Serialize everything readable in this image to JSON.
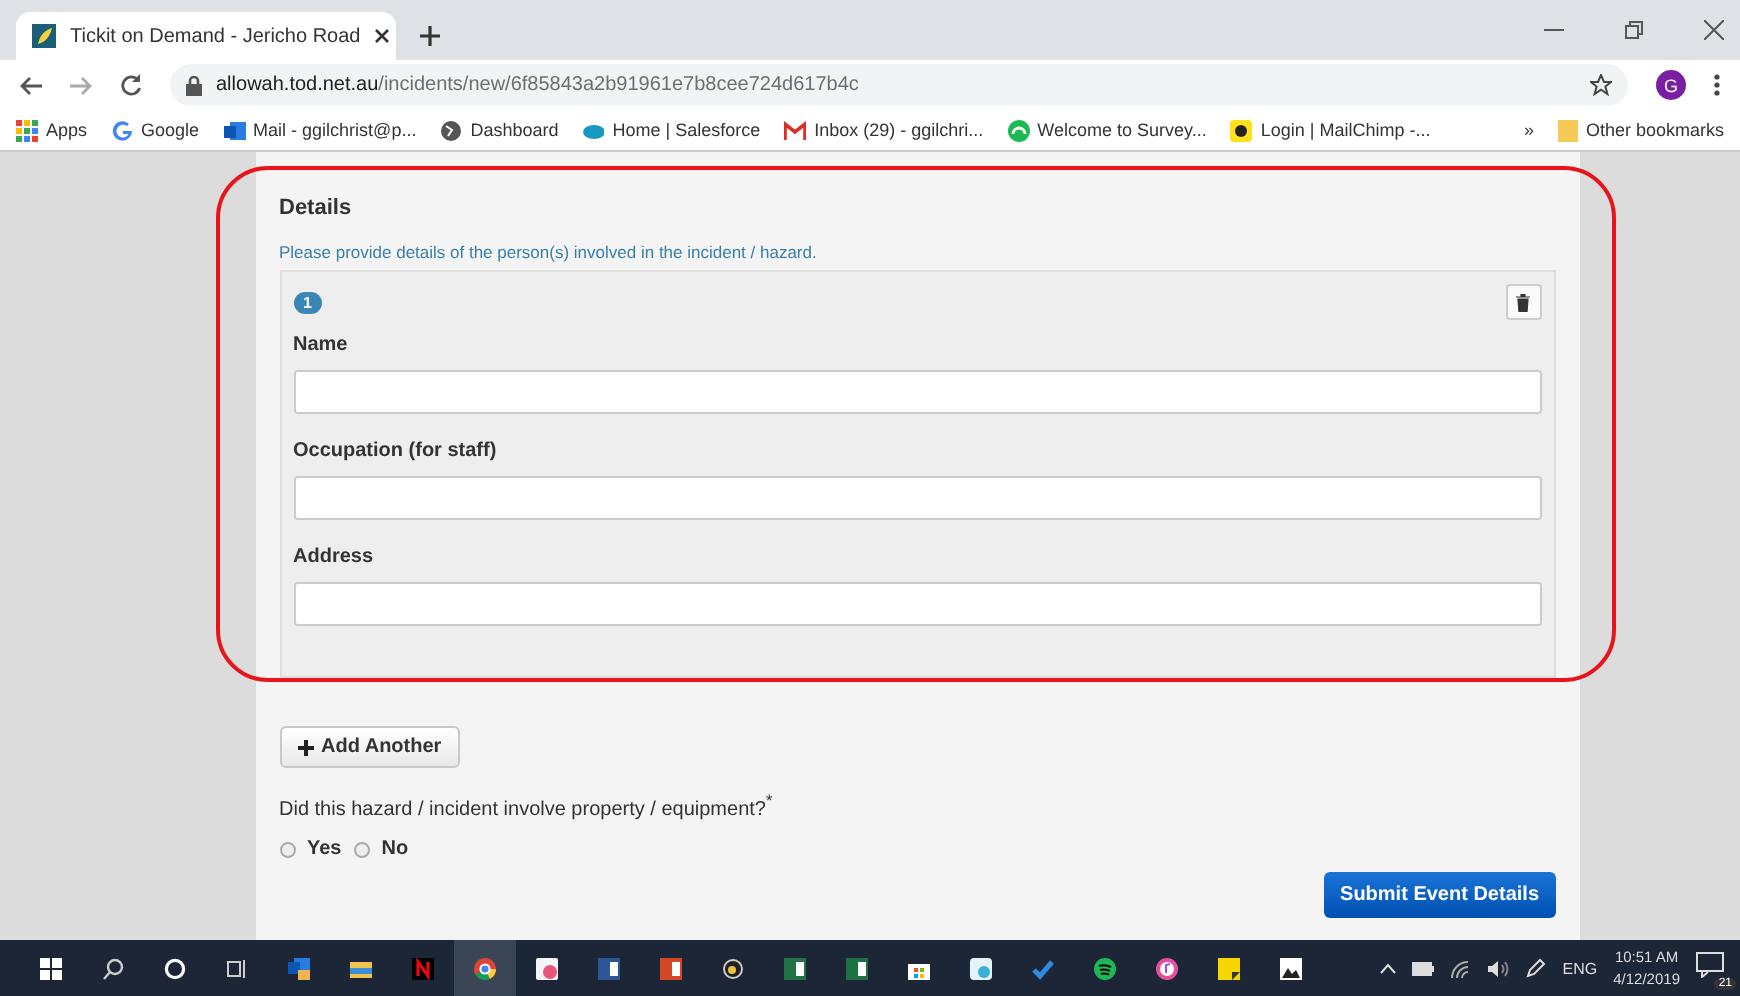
{
  "browser": {
    "tab_title": "Tickit on Demand - Jericho Road",
    "url_host": "allowah.tod.net.au",
    "url_path": "/incidents/new/6f85843a2b91961e7b8cee724d617b4c",
    "avatar": "G",
    "bookmarks": [
      {
        "label": "Apps",
        "kind": "apps"
      },
      {
        "label": "Google",
        "kind": "google"
      },
      {
        "label": "Mail - ggilchrist@p...",
        "kind": "outlook"
      },
      {
        "label": "Dashboard",
        "kind": "globe"
      },
      {
        "label": "Home | Salesforce",
        "kind": "cloud"
      },
      {
        "label": "Inbox (29) - ggilchri...",
        "kind": "gmail"
      },
      {
        "label": "Welcome to Survey...",
        "kind": "survey"
      },
      {
        "label": "Login | MailChimp -...",
        "kind": "chimp"
      }
    ],
    "overflow": "»",
    "other_bookmarks": "Other bookmarks"
  },
  "form": {
    "heading": "Details",
    "hint": "Please provide details of the person(s) involved in the incident / hazard.",
    "persons": [
      {
        "number": "1",
        "fields": [
          {
            "label": "Name"
          },
          {
            "label": "Occupation (for staff)"
          },
          {
            "label": "Address"
          }
        ]
      }
    ],
    "add_button": "Add Another",
    "question": "Did this hazard / incident involve property / equipment?",
    "required_mark": "*",
    "options": [
      {
        "label": "Yes",
        "selected": false
      },
      {
        "label": "No",
        "selected": false
      }
    ],
    "submit": "Submit Event Details"
  },
  "taskbar": {
    "language": "ENG",
    "time": "10:51 AM",
    "date": "4/12/2019",
    "notification_count": "21"
  }
}
